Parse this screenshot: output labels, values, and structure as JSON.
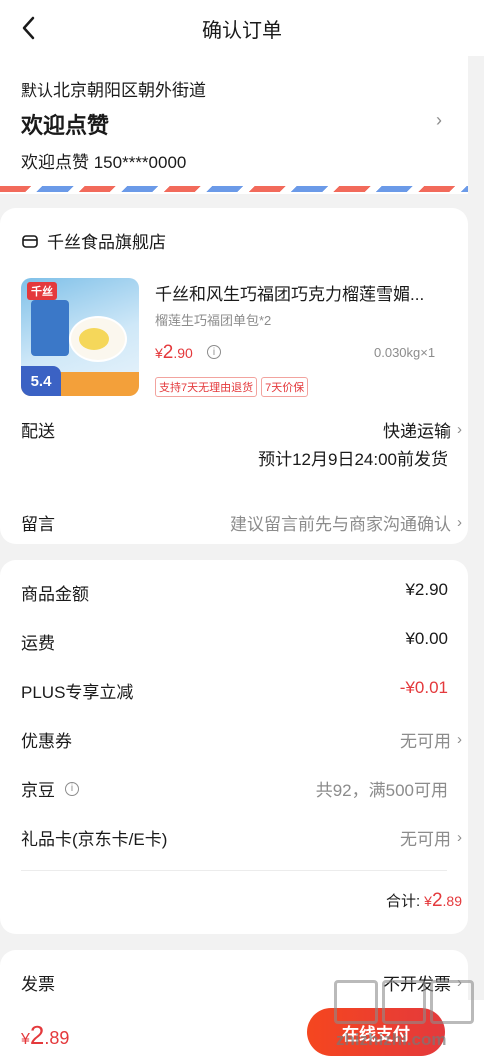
{
  "header": {
    "title": "确认订单"
  },
  "address": {
    "tag": "默认",
    "district": "北京朝阳区朝外街道",
    "name": "欢迎点赞",
    "contact": "欢迎点赞  150****0000"
  },
  "store": {
    "name": "千丝食品旗舰店",
    "product": {
      "title": "千丝和风生巧福团巧克力榴莲雪媚...",
      "spec": "榴莲生巧福团单包*2",
      "price": {
        "symbol": "¥",
        "int": "2",
        "dec": ".90"
      },
      "quantity": "0.030kg×1",
      "tags": [
        "支持7天无理由退货",
        "7天价保"
      ],
      "image_text": {
        "brand": "千丝",
        "badge": "5.4"
      }
    },
    "delivery": {
      "label": "配送",
      "method": "快递运输",
      "estimate": "预计12月9日24:00前发货"
    },
    "message": {
      "label": "留言",
      "placeholder": "建议留言前先与商家沟通确认"
    }
  },
  "summary": {
    "rows": [
      {
        "label": "商品金额",
        "value": "¥2.90"
      },
      {
        "label": "运费",
        "value": "¥0.00"
      },
      {
        "label": "PLUS专享立减",
        "value": "-¥0.01"
      },
      {
        "label": "优惠券",
        "value": "无可用"
      },
      {
        "label": "京豆",
        "value": "共92，满500可用"
      },
      {
        "label": "礼品卡(京东卡/E卡)",
        "value": "无可用"
      }
    ],
    "total_label": "合计:",
    "total": {
      "symbol": "¥",
      "int": "2",
      "dec": ".89"
    }
  },
  "invoice": {
    "label": "发票",
    "value": "不开发票"
  },
  "bottom": {
    "price": {
      "symbol": "¥",
      "int": "2",
      "dec": ".89"
    },
    "pay_label": "在线支付"
  },
  "watermark": {
    "url": "zhizhizhi.com"
  },
  "colors": {
    "accent": "#e4393c",
    "muted": "#8c8c8c",
    "background": "#f2f2f2"
  }
}
